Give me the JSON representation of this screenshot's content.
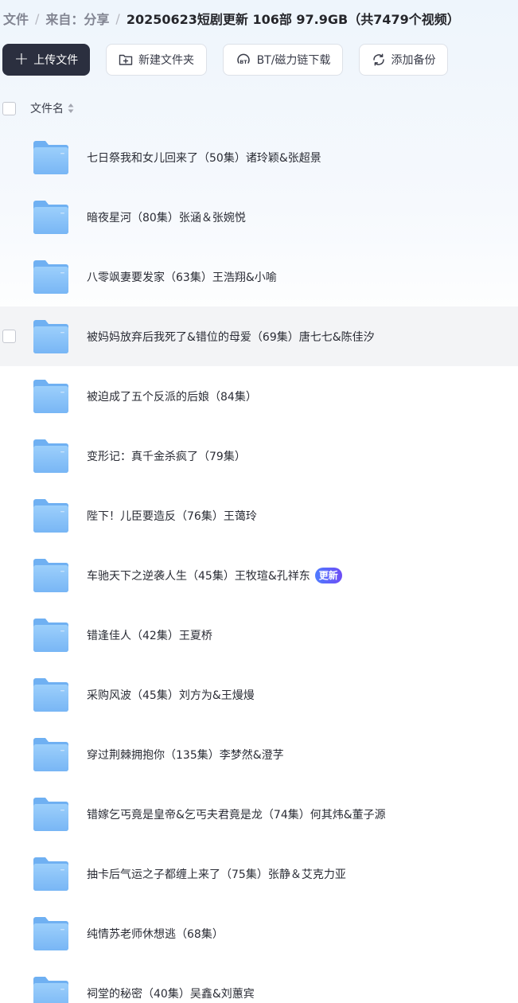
{
  "breadcrumb": {
    "root": "文件",
    "source": "来自：分享",
    "current": "20250623短剧更新 106部 97.9GB（共7479个视频）"
  },
  "toolbar": {
    "upload_label": "上传文件",
    "new_folder_label": "新建文件夹",
    "bt_label": "BT/磁力链下载",
    "backup_label": "添加备份"
  },
  "header": {
    "name_column": "文件名"
  },
  "files": [
    {
      "name": "七日祭我和女儿回来了（50集）诸玲颖&张超景",
      "badge": ""
    },
    {
      "name": "暗夜星河（80集）张涵＆张婉悦",
      "badge": ""
    },
    {
      "name": "八零飒妻要发家（63集）王浩翔&小喻",
      "badge": ""
    },
    {
      "name": "被妈妈放弃后我死了&错位的母爱（69集）唐七七&陈佳汐",
      "badge": ""
    },
    {
      "name": "被迫成了五个反派的后娘（84集）",
      "badge": ""
    },
    {
      "name": "变形记：真千金杀疯了（79集）",
      "badge": ""
    },
    {
      "name": "陛下！儿臣要造反（76集）王蔼玲",
      "badge": ""
    },
    {
      "name": "车驰天下之逆袭人生（45集）王牧瑄&孔祥东",
      "badge": "更新"
    },
    {
      "name": "错逢佳人（42集）王夏桥",
      "badge": ""
    },
    {
      "name": "采购风波（45集）刘方为&王熳熳",
      "badge": ""
    },
    {
      "name": "穿过荆棘拥抱你（135集）李梦然&澄芓",
      "badge": ""
    },
    {
      "name": "错嫁乞丐竟是皇帝&乞丐夫君竟是龙（74集）何其炜&董子源",
      "badge": ""
    },
    {
      "name": "抽卡后气运之子都缠上来了（75集）张静＆艾克力亚",
      "badge": ""
    },
    {
      "name": "纯情苏老师休想逃（68集）",
      "badge": ""
    },
    {
      "name": "祠堂的秘密（40集）吴鑫&刘蕙宾",
      "badge": ""
    }
  ]
}
